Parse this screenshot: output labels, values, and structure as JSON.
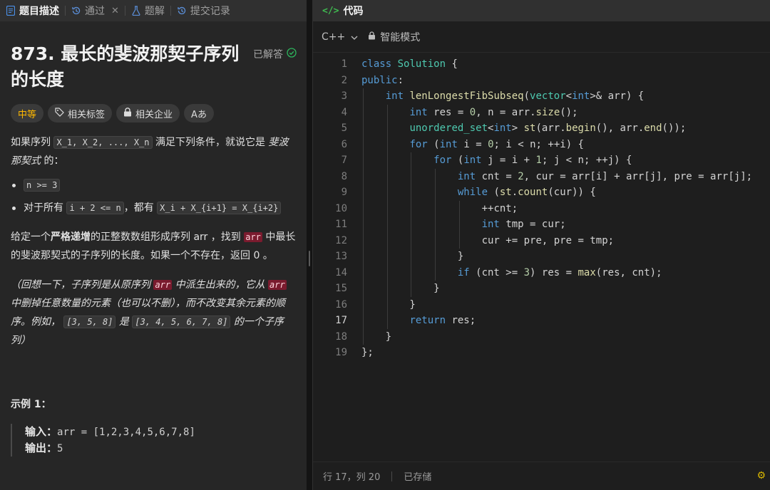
{
  "tabs": [
    {
      "label": "题目描述",
      "icon": "description-icon",
      "active": true
    },
    {
      "label": "通过",
      "icon": "history-icon",
      "closable": true
    },
    {
      "label": "题解",
      "icon": "flask-icon"
    },
    {
      "label": "提交记录",
      "icon": "history-icon"
    }
  ],
  "problem": {
    "title": "873. 最长的斐波那契子序列的长度",
    "status": "已解答",
    "tags": {
      "difficulty": "中等",
      "related_tags": "相关标签",
      "related_companies": "相关企业",
      "translate": "Aあ"
    },
    "desc": {
      "p1_pre": "如果序列 ",
      "p1_code": "X_1, X_2, ..., X_n",
      "p1_mid": " 满足下列条件，就说它是 ",
      "p1_em": "斐波那契式",
      "p1_post": " 的：",
      "cond1_code": "n >= 3",
      "cond2_pre": "对于所有 ",
      "cond2_code1": "i + 2 <= n",
      "cond2_mid": "，都有 ",
      "cond2_code2": "X_i + X_{i+1} = X_{i+2}",
      "p2_pre": "给定一个",
      "p2_bold": "严格递增",
      "p2_mid": "的正整数数组形成序列 arr ，找到 ",
      "p2_code": "arr",
      "p2_post": " 中最长的斐波那契式的子序列的长度。如果一个不存在，返回  0 。",
      "note_pre": "（回想一下，子序列是从原序列 ",
      "note_code1": "arr",
      "note_mid1": " 中派生出来的，它从 ",
      "note_code2": "arr",
      "note_mid2": " 中删掉任意数量的元素（也可以不删），而不改变其余元素的顺序。例如， ",
      "note_code3": "[3, 5, 8]",
      "note_mid3": " 是 ",
      "note_code4": "[3, 4, 5, 6, 7, 8]",
      "note_post": " 的一个子序列）"
    },
    "example": {
      "title": "示例 1：",
      "input_label": "输入：",
      "input_value": "arr = [1,2,3,4,5,6,7,8]",
      "output_label": "输出：",
      "output_value": "5"
    }
  },
  "editor": {
    "header": "代码",
    "language": "C++",
    "mode": "智能模式",
    "current_line": 17,
    "lines": [
      "class Solution {",
      "public:",
      "    int lenLongestFibSubseq(vector<int>& arr) {",
      "        int res = 0, n = arr.size();",
      "        unordered_set<int> st(arr.begin(), arr.end());",
      "        for (int i = 0; i < n; ++i) {",
      "            for (int j = i + 1; j < n; ++j) {",
      "                int cnt = 2, cur = arr[i] + arr[j], pre = arr[j];",
      "                while (st.count(cur)) {",
      "                    ++cnt;",
      "                    int tmp = cur;",
      "                    cur += pre, pre = tmp;",
      "                }",
      "                if (cnt >= 3) res = max(res, cnt);",
      "            }",
      "        }",
      "        return res;",
      "    }",
      "};"
    ],
    "status_position": "行 17，列 20",
    "status_saved": "已存储"
  }
}
